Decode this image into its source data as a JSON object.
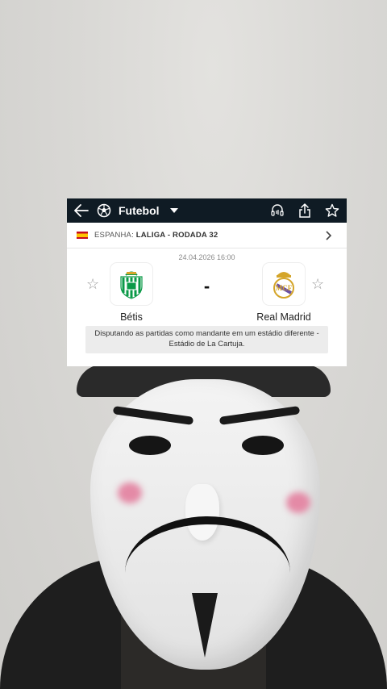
{
  "topbar": {
    "sport_label": "Futebol",
    "icons": [
      "back-arrow-icon",
      "soccer-ball-icon",
      "dropdown-caret-icon",
      "audio-icon",
      "share-icon",
      "star-icon"
    ]
  },
  "league": {
    "country": "ESPANHA:",
    "name": "LALIGA - RODADA 32"
  },
  "match": {
    "datetime": "24.04.2026 16:00",
    "score": "-",
    "home_team": "Bétis",
    "away_team": "Real Madrid",
    "note": "Disputando as partidas como mandante em um estádio diferente - Estádio de La Cartuja."
  },
  "colors": {
    "topbar_bg": "#0f1b24",
    "betis_green": "#0b9a48",
    "real_gold": "#d4a52a"
  }
}
